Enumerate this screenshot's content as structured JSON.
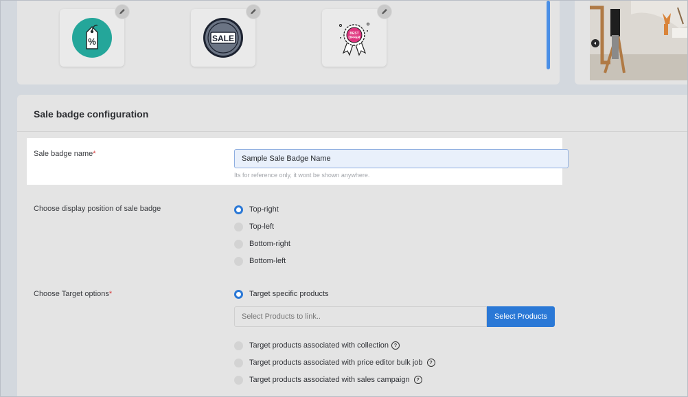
{
  "gallery": {
    "badges": [
      {
        "icon": "percent-tag-icon",
        "text": "%"
      },
      {
        "icon": "sale-circle-icon",
        "text": "SALE"
      },
      {
        "icon": "best-offer-rosette-icon",
        "text": "BEST OFFER"
      }
    ]
  },
  "config": {
    "title": "Sale badge configuration",
    "name_field": {
      "label": "Sale badge name",
      "required_mark": "*",
      "value": "Sample Sale Badge Name",
      "hint": "Its for reference only, it wont be shown anywhere."
    },
    "position": {
      "label": "Choose display position of sale badge",
      "options": [
        "Top-right",
        "Top-left",
        "Bottom-right",
        "Bottom-left"
      ],
      "selected": "Top-right"
    },
    "target": {
      "label": "Choose Target options",
      "required_mark": "*",
      "options": [
        "Target specific products",
        "Target products associated with collection",
        "Target products associated with price editor bulk job",
        "Target products associated with sales campaign"
      ],
      "selected": "Target specific products",
      "products_placeholder": "Select Products to link..",
      "select_button": "Select Products"
    }
  },
  "colors": {
    "accent": "#2a78d6",
    "required": "#d63c3c",
    "teal": "#24a69a",
    "pink": "#e0357f"
  }
}
